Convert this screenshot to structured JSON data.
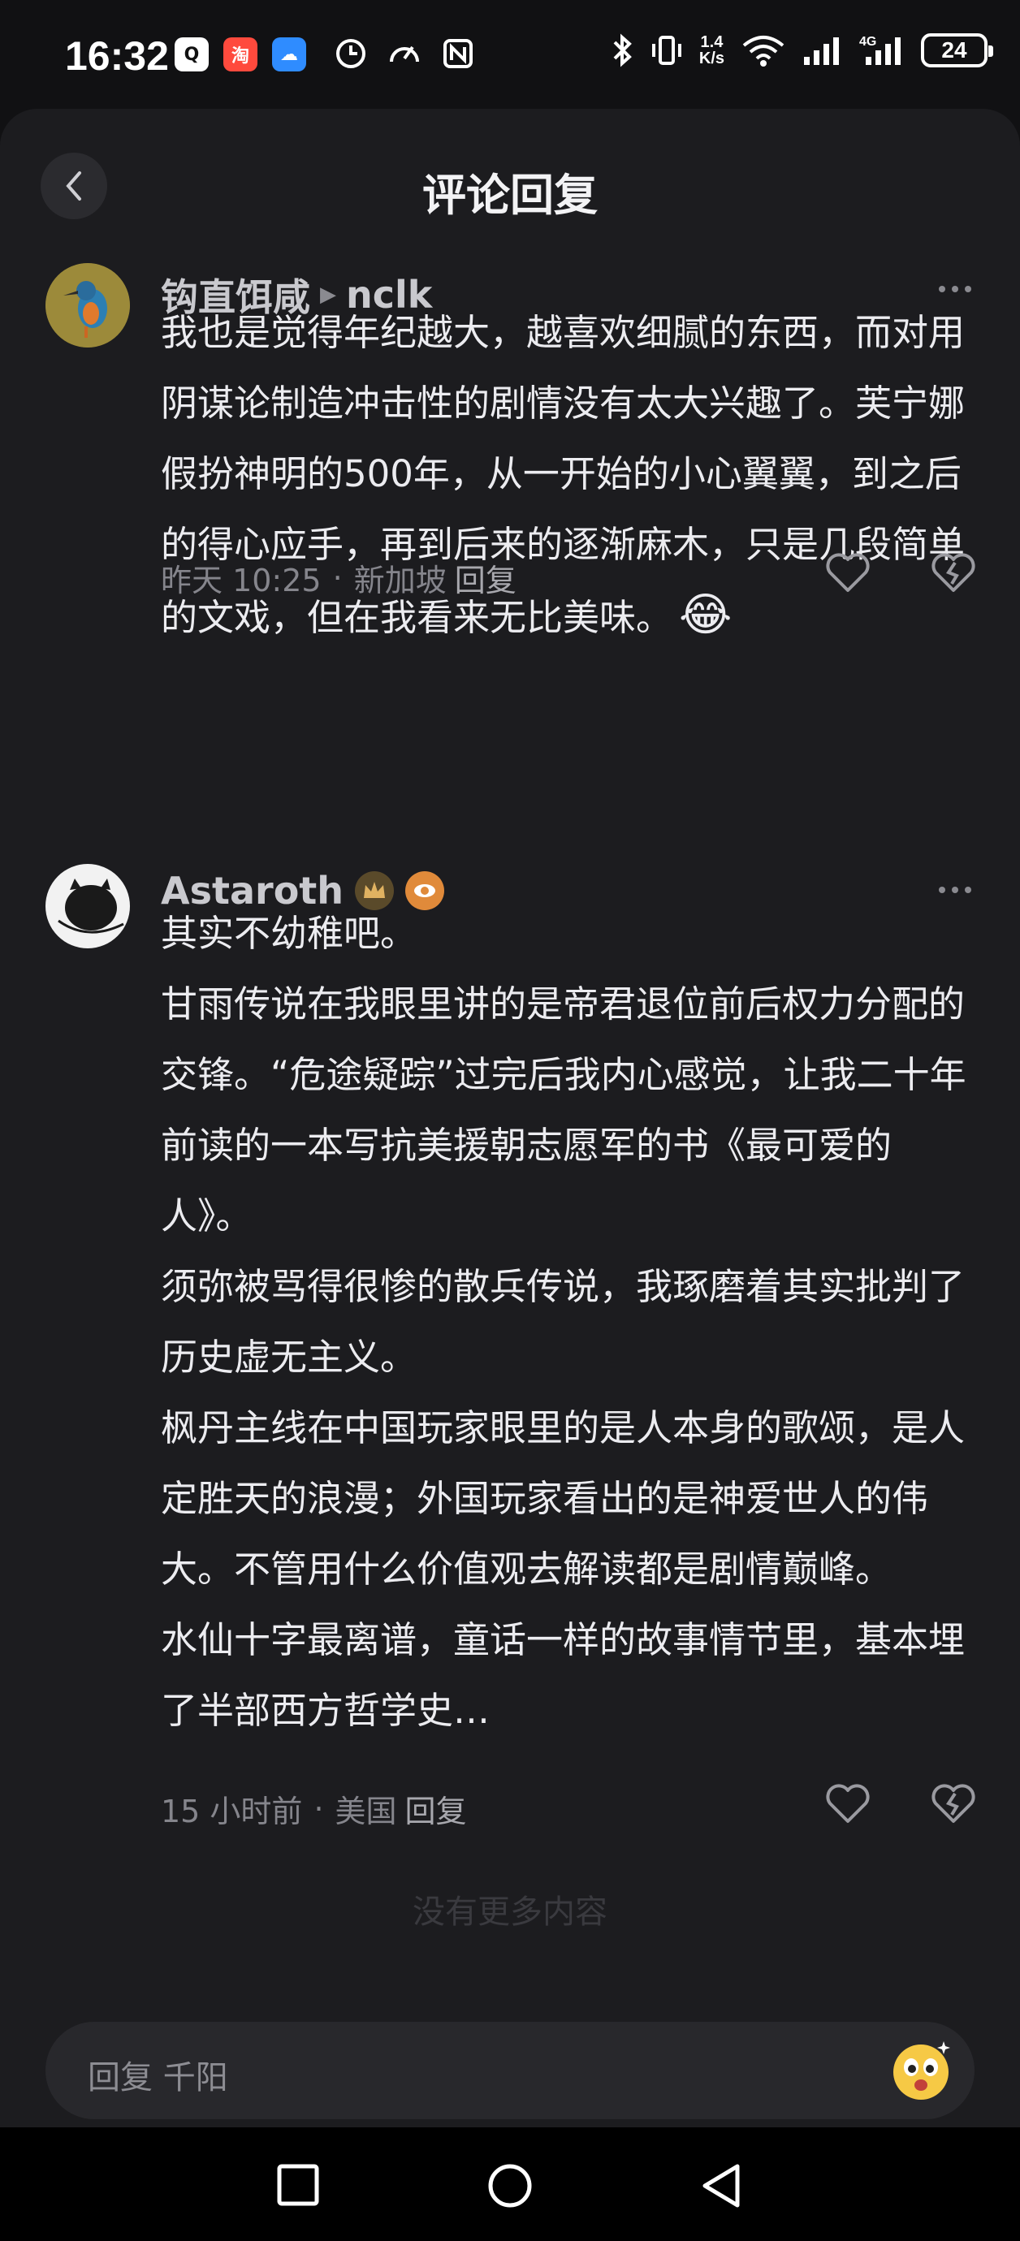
{
  "status_bar": {
    "time": "16:32",
    "apps": [
      {
        "name": "qq-app-icon",
        "color": "#ffffff",
        "glyph": "Q"
      },
      {
        "name": "taobao-app-icon",
        "color": "#ff4a3d",
        "glyph": "淘"
      },
      {
        "name": "weather-app-icon",
        "color": "#2f8cff",
        "glyph": "☁"
      }
    ],
    "net_speed_top": "1.4",
    "net_speed_bottom": "K/s",
    "battery": "24"
  },
  "header": {
    "title": "评论回复"
  },
  "comments": [
    {
      "author": "钩直饵咸",
      "reply_to": "nclk",
      "paragraphs": [
        "我也是觉得年纪越大，越喜欢细腻的东西，而对用阴谋论制造冲击性的剧情没有太大兴趣了。芙宁娜假扮神明的500年，从一开始的小心翼翼，到之后的得心应手，再到后来的逐渐麻木，只是几段简单的文戏，但在我看来无比美味。"
      ],
      "emoji": "😂",
      "time": "昨天 10:25",
      "location": "新加坡",
      "reply_label": "回复"
    },
    {
      "author": "Astaroth",
      "paragraphs": [
        "其实不幼稚吧。",
        "甘雨传说在我眼里讲的是帝君退位前后权力分配的交锋。“危途疑踪”过完后我内心感觉，让我二十年前读的一本写抗美援朝志愿军的书《最可爱的人》。",
        "须弥被骂得很惨的散兵传说，我琢磨着其实批判了历史虚无主义。",
        "枫丹主线在中国玩家眼里的是人本身的歌颂，是人定胜天的浪漫；外国玩家看出的是神爱世人的伟大。不管用什么价值观去解读都是剧情巅峰。",
        "水仙十字最离谱，童话一样的故事情节里，基本埋了半部西方哲学史…"
      ],
      "time": "15 小时前",
      "location": "美国",
      "reply_label": "回复"
    }
  ],
  "fade_text": "没有更多内容",
  "input": {
    "placeholder": "回复 千阳"
  },
  "colors": {
    "background": "#1c1c1f",
    "text": "#ececf0",
    "muted": "#85858c"
  }
}
